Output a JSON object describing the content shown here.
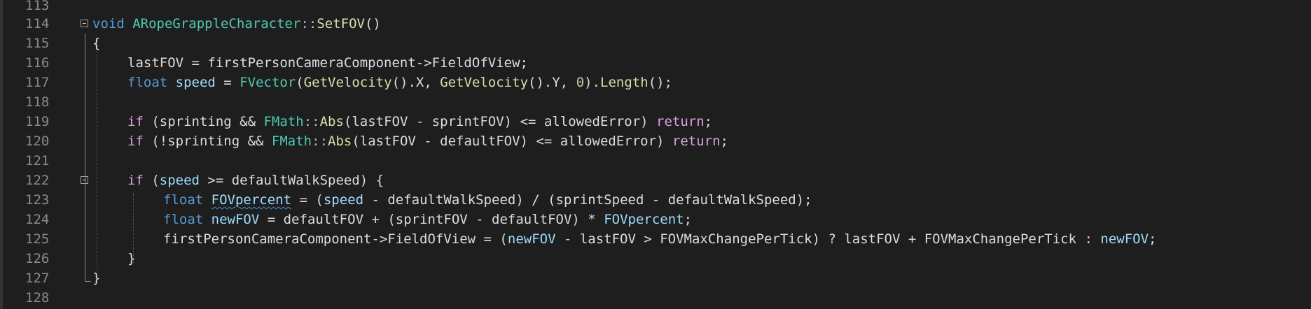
{
  "editor": {
    "lines": [
      {
        "n": "113"
      },
      {
        "n": "114"
      },
      {
        "n": "115"
      },
      {
        "n": "116"
      },
      {
        "n": "117"
      },
      {
        "n": "118"
      },
      {
        "n": "119"
      },
      {
        "n": "120"
      },
      {
        "n": "121"
      },
      {
        "n": "122"
      },
      {
        "n": "123"
      },
      {
        "n": "124"
      },
      {
        "n": "125"
      },
      {
        "n": "126"
      },
      {
        "n": "127"
      },
      {
        "n": "128"
      }
    ],
    "code": {
      "l114": {
        "void": "void",
        "cls": "ARopeGrappleCharacter",
        "scope": "::",
        "fn": "SetFOV",
        "parens": "()"
      },
      "l115": {
        "brace": "{"
      },
      "l116": {
        "a": "lastFOV = firstPersonCameraComponent->FieldOfView;"
      },
      "l117": {
        "float": "float",
        "speed": "speed",
        "eq": " = ",
        "fvector": "FVector",
        "p1": "(",
        "getvel1": "GetVelocity",
        "mid1": "().X, ",
        "getvel2": "GetVelocity",
        "mid2": "().Y, ",
        "zero": "0",
        "mid3": ").",
        "length": "Length",
        "end": "();"
      },
      "l119": {
        "if": "if",
        "a": " (sprinting && ",
        "fmath": "FMath",
        "scope": "::",
        "abs": "Abs",
        "b": "(lastFOV - sprintFOV) <= allowedError) ",
        "ret": "return",
        "semi": ";"
      },
      "l120": {
        "if": "if",
        "a": " (!sprinting && ",
        "fmath": "FMath",
        "scope": "::",
        "abs": "Abs",
        "b": "(lastFOV - defaultFOV) <= allowedError) ",
        "ret": "return",
        "semi": ";"
      },
      "l122": {
        "if": "if",
        "a": " (",
        "speed": "speed",
        "b": " >= defaultWalkSpeed) {"
      },
      "l123": {
        "float": "float",
        "var": "FOVpercent",
        "a": " = (",
        "speed": "speed",
        "b": " - defaultWalkSpeed) / (sprintSpeed - defaultWalkSpeed);"
      },
      "l124": {
        "float": "float",
        "var": "newFOV",
        "a": " = defaultFOV + (sprintFOV - defaultFOV) * ",
        "ref": "FOVpercent",
        "semi": ";"
      },
      "l125": {
        "a": "firstPersonCameraComponent->FieldOfView = (",
        "newfov1": "newFOV",
        "b": " - lastFOV > FOVMaxChangePerTick) ? lastFOV + FOVMaxChangePerTick : ",
        "newfov2": "newFOV",
        "semi": ";"
      },
      "l126": {
        "brace": "}"
      },
      "l127": {
        "brace": "}"
      }
    }
  },
  "colors": {
    "background": "#1e1e1e",
    "keyword": "#569cd6",
    "control_keyword": "#d8a0df",
    "type": "#4ec9b0",
    "function": "#dcdcaa",
    "local_variable": "#9cdcfe",
    "number": "#b5cea8",
    "text": "#dcdcdc",
    "line_number": "#8a8a8a"
  },
  "icons": [
    "collapse-minus-icon"
  ]
}
